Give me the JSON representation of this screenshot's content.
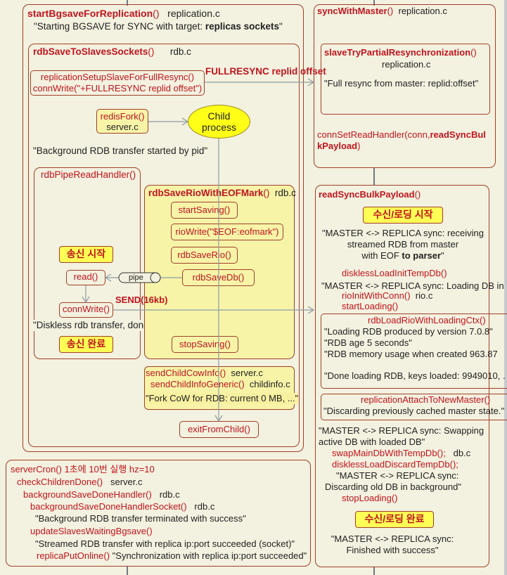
{
  "left": {
    "start_bgsave": {
      "fn": "startBgsaveForReplication",
      "parens": "()",
      "file": "replication.c",
      "msg_pre": "\"Starting BGSAVE for SYNC with target: ",
      "msg_bold": "replicas sockets",
      "msg_post": "\""
    },
    "rdb_save_to_slaves": {
      "fn": "rdbSaveToSlavesSockets",
      "parens": "()",
      "file": "rdb.c"
    },
    "setup_full_resync": {
      "line1": "replicationSetupSlaveForFullResync()",
      "line2": "connWrite(\"+FULLRESYNC replid offset\")"
    },
    "fullresync_label": "FULLRESYNC  replid  offset",
    "redis_fork": {
      "fn": "redisFork()",
      "file": "server.c"
    },
    "child_process": {
      "line1": "Child",
      "line2": "process"
    },
    "bg_started_msg": "\"Background RDB transfer started by pid\"",
    "pipe_read_handler": {
      "title": "rdbPipeReadHandler()",
      "badge_start": "송신 시작",
      "read": "read()",
      "conn_write": "connWrite()",
      "done_msg": "\"Diskless rdb transfer, done reading from pipe, ...\"",
      "badge_done": "송신 완료"
    },
    "pipe_label": "pipe",
    "send_label": "SEND(16kb)",
    "rio_eof": {
      "fn": "rdbSaveRioWithEOFMark",
      "parens": "()",
      "file": "rdb.c",
      "steps": [
        "startSaving()",
        "rioWrite(\"$EOF:eofmark\")",
        "rdbSaveRio()",
        "rdbSaveDb()",
        "stopSaving()"
      ]
    },
    "child_cow": {
      "fn1": "sendChildCowInfo()",
      "file1": "server.c",
      "fn2": "sendChildInfoGeneric()",
      "file2": "childinfo.c",
      "msg": "\"Fork CoW for RDB: current 0 MB, ...\""
    },
    "exit_from_child": "exitFromChild()",
    "server_cron": {
      "title": "serverCron() 1초에 10번 실행 hz=10",
      "check_children": {
        "fn": "checkChildrenDone()",
        "file": "server.c"
      },
      "bg_done_handler": {
        "fn": "backgroundSaveDoneHandler()",
        "file": "rdb.c"
      },
      "bg_done_socket": {
        "fn": "backgroundSaveDoneHandlerSocket()",
        "file": "rdb.c"
      },
      "bg_terminated_msg": "\"Background RDB transfer terminated with success\"",
      "update_slaves": "updateSlavesWaitingBgsave()",
      "streamed_msg": "\"Streamed  RDB transfer with  replica ip:port succeeded  (socket)\"",
      "put_online_fn": "replicaPutOnline()",
      "put_online_msg": " \"Synchronization with replica ip:port succeeded\""
    }
  },
  "right": {
    "sync_with_master": {
      "fn": "syncWithMaster",
      "parens": "()",
      "file": "replication.c"
    },
    "partial_resync": {
      "fn": "slaveTryPartialResynchronization",
      "parens": "()",
      "file": "replication.c",
      "msg": "\"Full resync from master: replid:offset\""
    },
    "set_read_handler": {
      "pre": "connSetReadHandler(conn,",
      "bold1": "readSyncBul",
      "bold2": "kPayload",
      "post": ")"
    },
    "read_sync_bulk": {
      "fn": "readSyncBulkPayload",
      "parens": "()",
      "badge_start": "수신/로딩 시작",
      "recv_msg": [
        "\"MASTER <-> REPLICA sync: receiving",
        "streamed  RDB from  master",
        "with EOF "
      ],
      "recv_msg_bold": "to parser",
      "recv_msg_end": "\"",
      "init_temp_db": "disklessLoadInitTempDb()",
      "loading_msg": "\"MASTER <-> REPLICA sync: Loading DB in",
      "rio_init": {
        "fn": "rioInitWithConn()",
        "file": "rio.c"
      },
      "start_loading": "startLoading()",
      "load_ctx": {
        "fn": "rdbLoadRioWithLoadingCtx()",
        "lines": [
          "\"Loading RDB produced by version 7.0.8\"",
          "\"RDB age 5 seconds\"",
          "\"RDB memory  usage when created  963.87",
          "\"Done loading RDB, keys loaded: 9949010, ."
        ]
      },
      "attach_master": {
        "fn": "replicationAttachToNewMaster()",
        "msg": "\"Discarding previously  cached master state.\""
      },
      "swap_msg": [
        "\"MASTER <-> REPLICA sync: Swapping",
        "active  DB with loaded DB\""
      ],
      "swap_fn": "swapMainDbWithTempDb();",
      "swap_file": "db.c",
      "discard_fn": "disklessLoadDiscardTempDb();",
      "discard_msg": [
        "\"MASTER <-> REPLICA sync:",
        "Discarding old DB in background\""
      ],
      "stop_loading": "stopLoading()",
      "badge_done": "수신/로딩 완료",
      "finish_msg": [
        "\"MASTER <-> REPLICA sync:",
        "Finished with success\""
      ]
    }
  }
}
